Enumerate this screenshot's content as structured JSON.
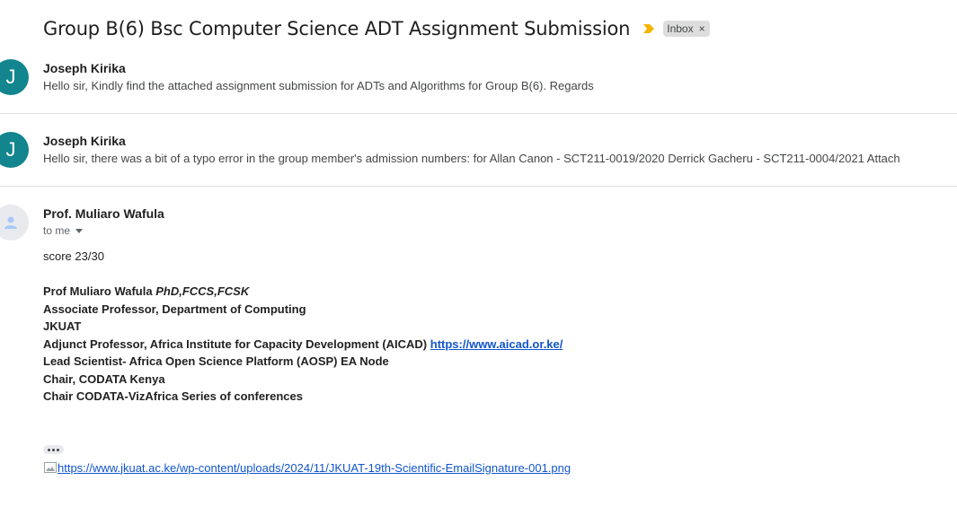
{
  "thread": {
    "subject": "Group B(6) Bsc Computer Science ADT Assignment Submission",
    "label": "Inbox",
    "label_remove": "×",
    "importance_icon": "importance-marker-icon",
    "importance_color": "#f4b400"
  },
  "messages": [
    {
      "avatar_letter": "J",
      "avatar_color": "#12858e",
      "sender": "Joseph Kirika",
      "snippet": "Hello sir, Kindly find the attached assignment submission for ADTs and Algorithms for Group B(6). Regards"
    },
    {
      "avatar_letter": "J",
      "avatar_color": "#12858e",
      "sender": "Joseph Kirika",
      "snippet": "Hello sir, there was a bit of a typo error in the group member's admission numbers: for Allan Canon - SCT211-0019/2020 Derrick Gacheru - SCT211-0004/2021 Attach"
    }
  ],
  "open_message": {
    "avatar_icon": "default-person-icon",
    "sender": "Prof. Muliaro Wafula",
    "recipient": "to me",
    "body": {
      "score": "score 23/30",
      "sig_name": "Prof Muliaro Wafula",
      "sig_titles": "PhD,FCCS,FCSK",
      "sig_line1": "Associate Professor, Department of Computing",
      "sig_line2": "JKUAT",
      "sig_line3": "Adjunct Professor, Africa Institute for Capacity Development (AICAD)",
      "sig_link": "https://www.aicad.or.ke/",
      "sig_line4": "Lead Scientist- Africa Open Science Platform (AOSP) EA Node",
      "sig_line5": "Chair, CODATA Kenya",
      "sig_line6": "Chair CODATA-VizAfrica Series of conferences"
    },
    "image_alt": "https://www.jkuat.ac.ke/wp-content/uploads/2024/11/JKUAT-19th-Scientific-EmailSignature-001.png"
  }
}
